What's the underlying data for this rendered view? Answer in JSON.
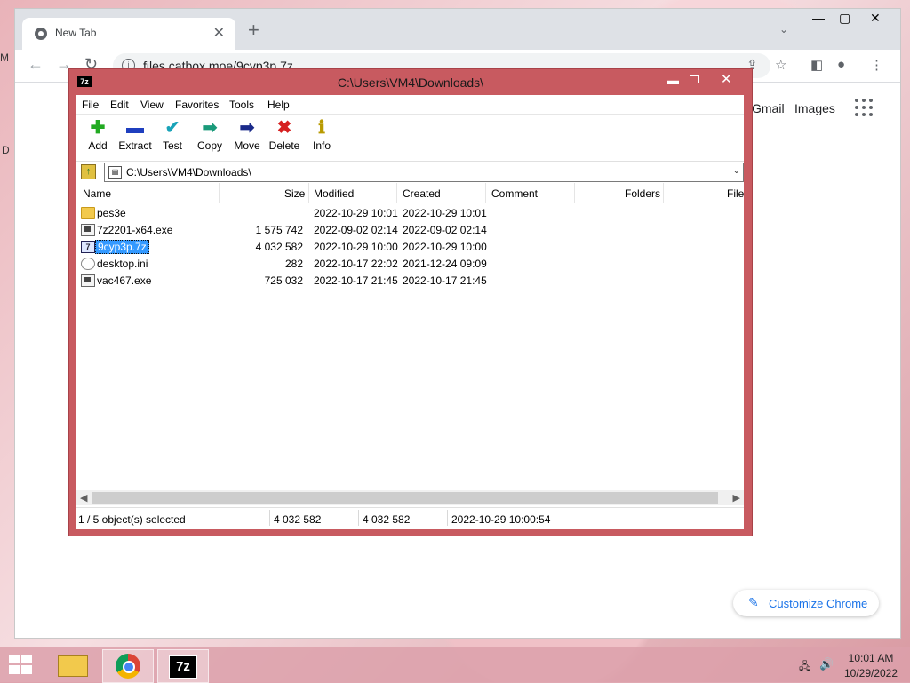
{
  "desktop": {
    "edge_label_1": "M",
    "edge_label_2": "D"
  },
  "browser": {
    "tab_title": "New Tab",
    "tab_close": "✕",
    "new_tab": "+",
    "url": "files.catbox.moe/9cyp3p.7z",
    "links": {
      "gmail": "Gmail",
      "images": "Images"
    },
    "customize_label": "Customize Chrome"
  },
  "sevenzip": {
    "title": "C:\\Users\\VM4\\Downloads\\",
    "app_icon": "7z",
    "menu": [
      "File",
      "Edit",
      "View",
      "Favorites",
      "Tools",
      "Help"
    ],
    "toolbar": [
      {
        "label": "Add",
        "icon": "add-icon",
        "glyph": "✚",
        "color": "#22aa22"
      },
      {
        "label": "Extract",
        "icon": "extract-icon",
        "glyph": "▬",
        "color": "#1f3fbf"
      },
      {
        "label": "Test",
        "icon": "test-icon",
        "glyph": "✔",
        "color": "#19a3b8"
      },
      {
        "label": "Copy",
        "icon": "copy-icon",
        "glyph": "➡",
        "color": "#1a9a7a"
      },
      {
        "label": "Move",
        "icon": "move-icon",
        "glyph": "➡",
        "color": "#1a2a8a"
      },
      {
        "label": "Delete",
        "icon": "delete-icon",
        "glyph": "✖",
        "color": "#d62020"
      },
      {
        "label": "Info",
        "icon": "info-icon",
        "glyph": "ℹ",
        "color": "#b89a00"
      }
    ],
    "path": "C:\\Users\\VM4\\Downloads\\",
    "columns": [
      "Name",
      "Size",
      "Modified",
      "Created",
      "Comment",
      "Folders",
      "File"
    ],
    "files": [
      {
        "name": "pes3e",
        "size": "",
        "modified": "2022-10-29 10:01",
        "created": "2022-10-29 10:01",
        "type": "folder",
        "selected": false
      },
      {
        "name": "7z2201-x64.exe",
        "size": "1 575 742",
        "modified": "2022-09-02 02:14",
        "created": "2022-09-02 02:14",
        "type": "exe",
        "selected": false
      },
      {
        "name": "9cyp3p.7z",
        "size": "4 032 582",
        "modified": "2022-10-29 10:00",
        "created": "2022-10-29 10:00",
        "type": "archive",
        "selected": true
      },
      {
        "name": "desktop.ini",
        "size": "282",
        "modified": "2022-10-17 22:02",
        "created": "2021-12-24 09:09",
        "type": "ini",
        "selected": false
      },
      {
        "name": "vac467.exe",
        "size": "725 032",
        "modified": "2022-10-17 21:45",
        "created": "2022-10-17 21:45",
        "type": "exe",
        "selected": false
      }
    ],
    "status": {
      "selection": "1 / 5 object(s) selected",
      "size": "4 032 582",
      "packed": "4 032 582",
      "time": "2022-10-29 10:00:54"
    }
  },
  "taskbar": {
    "sevenzip_icon": "7z",
    "time": "10:01 AM",
    "date": "10/29/2022"
  }
}
